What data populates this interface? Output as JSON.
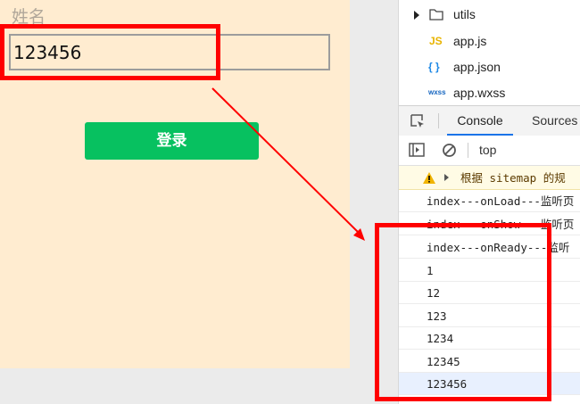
{
  "simulator": {
    "field_label": "姓名",
    "input_value": "123456",
    "login_label": "登录"
  },
  "devtools": {
    "files": [
      {
        "icon": "folder-icon",
        "label": "utils"
      },
      {
        "icon": "js-file-icon",
        "label": "app.js",
        "badge": "JS"
      },
      {
        "icon": "json-file-icon",
        "label": "app.json",
        "badge": "{ }"
      },
      {
        "icon": "wxss-file-icon",
        "label": "app.wxss",
        "badge": "wxss"
      }
    ],
    "tabs": [
      "Console",
      "Sources"
    ],
    "context": "top",
    "logs": [
      {
        "text": "根据 sitemap 的规",
        "level": "warning"
      },
      {
        "text": "index---onLoad---监听页"
      },
      {
        "text": "index---onShow---监听页"
      },
      {
        "text": "index---onReady---监听"
      },
      {
        "text": "1"
      },
      {
        "text": "12"
      },
      {
        "text": "123"
      },
      {
        "text": "1234"
      },
      {
        "text": "12345"
      },
      {
        "text": "123456"
      }
    ]
  },
  "colors": {
    "simulator_bg": "#ffecd0",
    "login_button": "#07c160",
    "annotation": "#ff0000",
    "console_tab_underline": "#1a73e8"
  }
}
